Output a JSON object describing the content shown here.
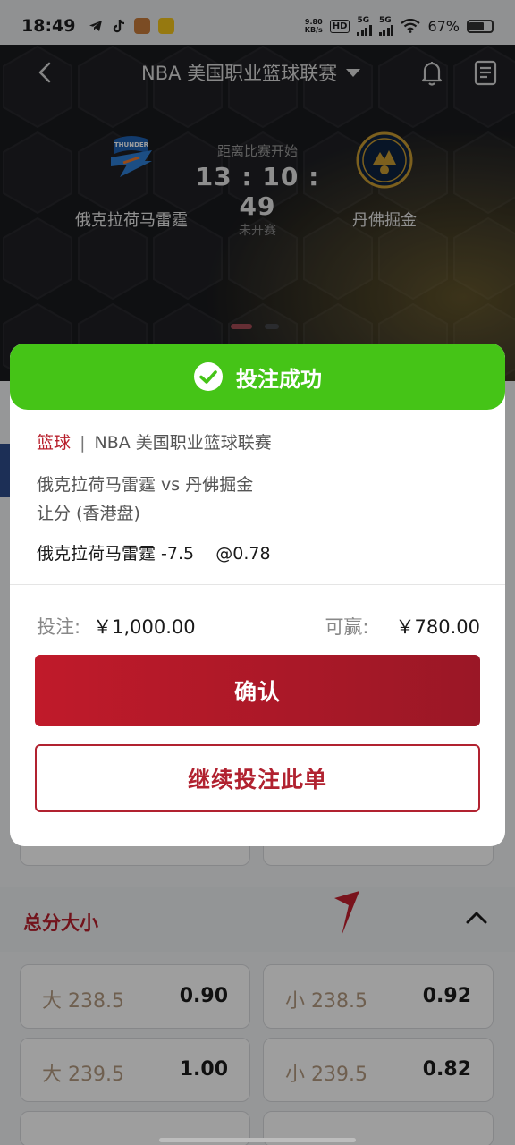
{
  "status_bar": {
    "time": "18:49",
    "net_speed_value": "9.80",
    "net_speed_unit": "KB/s",
    "hd_badge": "HD",
    "sim1_type": "5G",
    "sim2_type": "5G",
    "battery_text": "67%"
  },
  "header": {
    "league_title": "NBA 美国职业篮球联赛"
  },
  "match": {
    "home_team": "俄克拉荷马雷霆",
    "away_team": "丹佛掘金",
    "countdown_label": "距离比赛开始",
    "countdown": "13 : 10 : 49",
    "status": "未开赛"
  },
  "modal": {
    "title": "投注成功",
    "sport": "篮球",
    "separator": "|",
    "league": "NBA 美国职业篮球联赛",
    "matchup": "俄克拉荷马雷霆 vs 丹佛掘金",
    "market": "让分 (香港盘)",
    "selection": "俄克拉荷马雷霆 -7.5    @0.78",
    "stake_label": "投注:",
    "stake_value": "￥1,000.00",
    "payout_label": "可赢:",
    "payout_value": "￥780.00",
    "confirm_label": "确认",
    "continue_label": "继续投注此单"
  },
  "markets": {
    "section_title": "总分大小",
    "rows": [
      {
        "left_label": "大 238.5",
        "left_odds": "0.90",
        "right_label": "小 238.5",
        "right_odds": "0.92"
      },
      {
        "left_label": "大 239.5",
        "left_odds": "1.00",
        "right_label": "小 239.5",
        "right_odds": "0.82"
      }
    ]
  },
  "colors": {
    "success_green": "#45c417",
    "brand_red": "#b8202c",
    "banner_bg": "#191a1d"
  }
}
